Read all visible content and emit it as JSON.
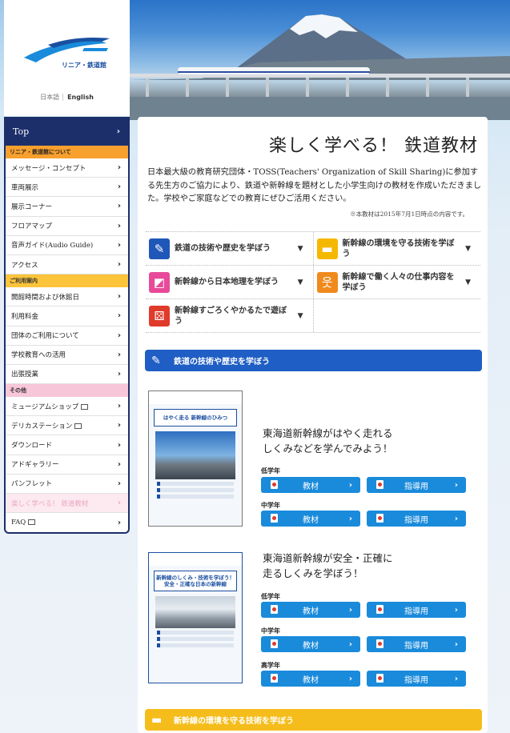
{
  "logo": {
    "name": "リニア・鉄道館"
  },
  "lang": {
    "ja": "日本語",
    "en": "English"
  },
  "nav": {
    "top": "Top",
    "sec1": "リニア・鉄道館について",
    "items1": [
      "メッセージ・コンセプト",
      "車両展示",
      "展示コーナー",
      "フロアマップ",
      "音声ガイド(Audio Guide)",
      "アクセス"
    ],
    "sec2": "ご利用案内",
    "items2": [
      "開館時間および休館日",
      "利用料金",
      "団体のご利用について",
      "学校教育への活用",
      "出張授業"
    ],
    "sec3": "その他",
    "items3": [
      "ミュージアムショップ",
      "デリカステーション",
      "ダウンロード",
      "アドギャラリー",
      "パンフレット",
      "楽しく学べる！ 鉄道教材",
      "FAQ"
    ]
  },
  "page": {
    "title": "楽しく学べる！ 鉄道教材",
    "intro": "日本最大級の教育研究団体・TOSS(Teachers' Organization of Skill Sharing)に参加する先生方のご協力により、鉄道や新幹線を題材とした小学生向けの教材を作成いただきました。学校やご家庭などでの教育にぜひご活用ください。",
    "note": "※本教材は2015年7月1日時点の内容です。"
  },
  "topics": [
    {
      "label": "鉄道の技術や歴史を学ぼう",
      "icon": "pencil-icon",
      "color": "#1f57b8"
    },
    {
      "label": "新幹線の環境を守る技術を学ぼう",
      "icon": "train-icon",
      "color": "#f5b800"
    },
    {
      "label": "新幹線から日本地理を学ぼう",
      "icon": "map-icon",
      "color": "#e84a9a"
    },
    {
      "label": "新幹線で働く人々の仕事内容を学ぼう",
      "icon": "people-icon",
      "color": "#f08a1c"
    },
    {
      "label": "新幹線すごろくやかるたで遊ぼう",
      "icon": "dice-icon",
      "color": "#e03a2b"
    }
  ],
  "sections": {
    "tech": {
      "title": "鉄道の技術や歴史を学ぼう",
      "color": "#1f5ec4"
    },
    "env": {
      "title": "新幹線の環境を守る技術を学ぼう",
      "color": "#f5bd1c"
    }
  },
  "materials": [
    {
      "thumb_title": "はやく走る 新幹線のひみつ",
      "text1": "東海道新幹線がはやく走れる",
      "text2": "しくみなどを学んでみよう！",
      "grades": [
        "低学年",
        "中学年"
      ]
    },
    {
      "thumb_title": "新幹線のしくみ・技術を学ぼう！ 安全・正確な日本の新幹線",
      "text1": "東海道新幹線が安全・正確に",
      "text2": "走るしくみを学ぼう！",
      "grades": [
        "低学年",
        "中学年",
        "高学年"
      ]
    }
  ],
  "buttons": {
    "material": "教材",
    "guide": "指導用"
  }
}
